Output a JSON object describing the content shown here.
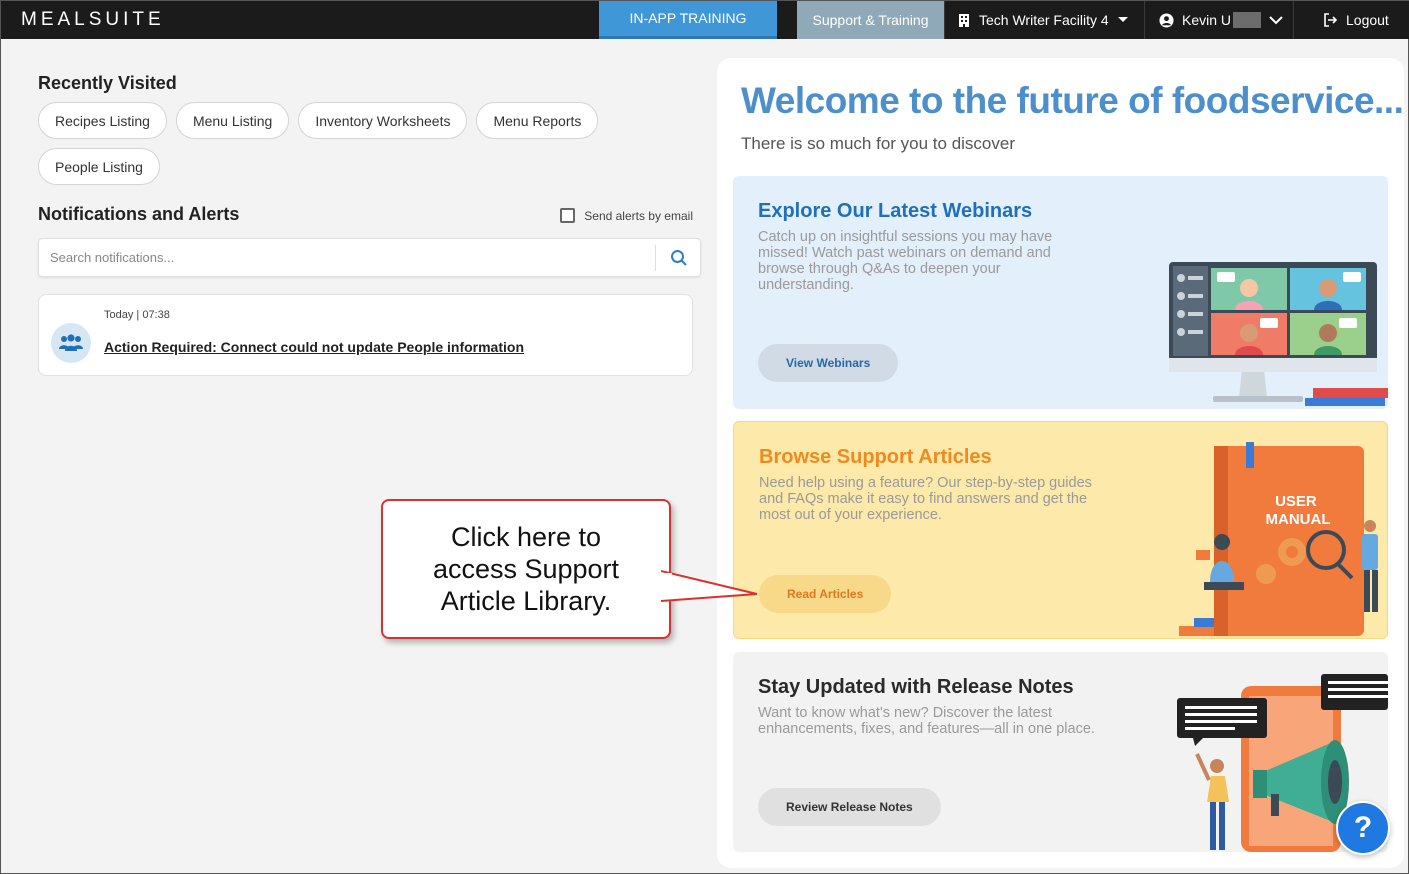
{
  "topbar": {
    "logo": "MEALSUITE",
    "training": "IN-APP TRAINING",
    "support": "Support & Training",
    "facility": "Tech Writer Facility 4",
    "user": "Kevin U",
    "logout": "Logout"
  },
  "recent": {
    "title": "Recently Visited",
    "items": [
      "Recipes Listing",
      "Menu Listing",
      "Inventory Worksheets",
      "Menu Reports",
      "People Listing"
    ]
  },
  "notifications": {
    "title": "Notifications and Alerts",
    "send_alerts": "Send alerts by email",
    "search_placeholder": "Search notifications...",
    "item": {
      "time": "Today | 07:38",
      "text": "Action Required: Connect could not update People information"
    }
  },
  "welcome": {
    "title": "Welcome to the future of foodservice...",
    "subtitle": "There is so much for you to discover"
  },
  "cards": {
    "webinars": {
      "title": "Explore Our Latest Webinars",
      "desc": "Catch up on insightful sessions you may have missed! Watch past webinars on demand and browse through Q&As to deepen your understanding.",
      "button": "View Webinars"
    },
    "articles": {
      "title": "Browse Support Articles",
      "desc": "Need help using a feature? Our step-by-step guides and FAQs make it easy to find answers and get the most out of your experience.",
      "button": "Read Articles",
      "book_text": "USER MANUAL"
    },
    "release": {
      "title": "Stay Updated with Release Notes",
      "desc": "Want to know what's new? Discover the latest enhancements, fixes, and features—all in one place.",
      "button": "Review Release Notes"
    }
  },
  "callout": {
    "text": "Click here to access Support Article Library."
  },
  "help": {
    "label": "?"
  },
  "colors": {
    "topbar": "#1b1b1b",
    "training": "#3f97d8",
    "support": "#8fa9b9",
    "welcome": "#4d8fcb",
    "webinars_title": "#1f6fb9",
    "articles_title": "#f08a1e",
    "callout_border": "#d9322e"
  }
}
